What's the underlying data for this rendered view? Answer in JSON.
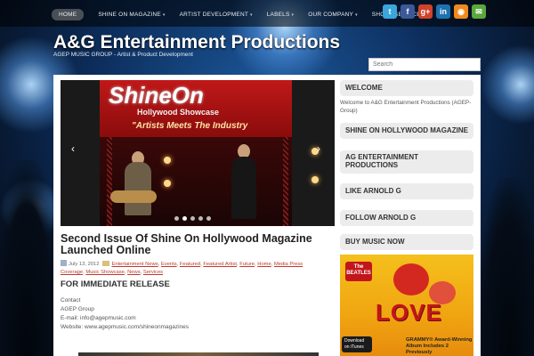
{
  "nav": {
    "items": [
      {
        "label": "HOME",
        "caret": false,
        "active": true
      },
      {
        "label": "SHINE ON MAGAZINE",
        "caret": true,
        "active": false
      },
      {
        "label": "ARTIST DEVELOPMENT",
        "caret": true,
        "active": false
      },
      {
        "label": "LABELS",
        "caret": true,
        "active": false
      },
      {
        "label": "OUR COMPANY",
        "caret": true,
        "active": false
      },
      {
        "label": "SHOP / SERVICES",
        "caret": true,
        "active": false
      }
    ],
    "caret_glyph": "▾"
  },
  "social": [
    {
      "icon": "twitter-icon",
      "glyph": "t",
      "color": "#3aa6de"
    },
    {
      "icon": "facebook-icon",
      "glyph": "f",
      "color": "#3b5998"
    },
    {
      "icon": "google-plus-icon",
      "glyph": "g+",
      "color": "#d0422a"
    },
    {
      "icon": "linkedin-icon",
      "glyph": "in",
      "color": "#1e72b0"
    },
    {
      "icon": "rss-icon",
      "glyph": "◉",
      "color": "#f08a1c"
    },
    {
      "icon": "email-icon",
      "glyph": "✉",
      "color": "#5aa83c"
    }
  ],
  "header": {
    "title": "A&G Entertainment Productions",
    "tagline": "AGEP MUSIC GROUP - Artist & Product Development"
  },
  "search": {
    "placeholder": "Search"
  },
  "slider": {
    "brand": "ShineOn",
    "subtitle": "Hollywood Showcase",
    "tagline": "\"Artists Meets The Industry",
    "prev_glyph": "‹",
    "next_glyph": "›",
    "slide_count": 5,
    "active_index": 1
  },
  "post": {
    "title": "Second Issue Of Shine On Hollywood Magazine Launched Online",
    "date": "July 13, 2012",
    "categories": [
      "Entertainment News",
      "Events",
      "Featured",
      "Featured Artist",
      "Future",
      "Home",
      "Media Press Coverage",
      "Music Showcase",
      "News",
      "Services"
    ],
    "release": "FOR IMMEDIATE RELEASE",
    "contact_lines": [
      "Contact",
      "AGEP Group",
      "E-mail: info@agepmusic.com",
      "Website: www.agepmusic.com/shineonmagazines"
    ]
  },
  "sidebar": {
    "welcome_heading": "WELCOME",
    "welcome_text": "Welcome to A&G Entertainment Productions (AGEP-Group)",
    "magazine_heading": "SHINE ON HOLLYWOOD MAGAZINE",
    "ag_heading": "AG ENTERTAINMENT PRODUCTIONS",
    "like_heading": "LIKE ARNOLD G",
    "follow_heading": "FOLLOW ARNOLD G",
    "buy_heading": "BUY MUSIC NOW",
    "album": {
      "band": "The BEATLES",
      "title": "LOVE",
      "itunes": "Download on iTunes",
      "grammy": "GRAMMY® Award-Winning Album Includes 2 Previously"
    }
  }
}
